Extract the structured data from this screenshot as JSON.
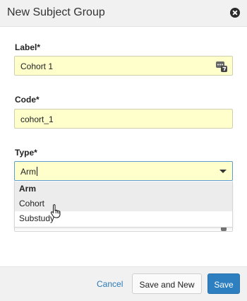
{
  "dialog": {
    "title": "New Subject Group"
  },
  "form": {
    "label": {
      "label": "Label*",
      "value": "Cohort 1"
    },
    "code": {
      "label": "Code*",
      "value": "cohort_1"
    },
    "type": {
      "label": "Type*",
      "value": "Arm",
      "options": [
        "Arm",
        "Cohort",
        "Substudy"
      ],
      "selected_option": "Arm",
      "hovered_option": "Cohort"
    }
  },
  "footer": {
    "cancel_label": "Cancel",
    "save_and_new_label": "Save and New",
    "save_label": "Save"
  },
  "colors": {
    "field_background": "#ffffcc",
    "primary_button": "#2d7fc0",
    "link": "#2a7ab8"
  },
  "icons": {
    "close": "close-icon",
    "keyboard": "keyboard-icon",
    "dropdown": "chevron-down-icon",
    "cursor": "hand-cursor-icon"
  }
}
